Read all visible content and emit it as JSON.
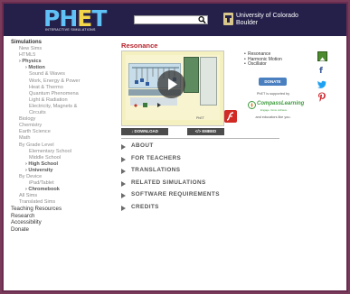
{
  "header": {
    "logo_text_ph": "PH",
    "logo_text_e": "E",
    "logo_text_t": "T",
    "logo_subtitle": "INTERACTIVE SIMULATIONS",
    "search_placeholder": "",
    "cu_line1": "University of Colorado",
    "cu_line2": "Boulder"
  },
  "sidebar": {
    "items": [
      {
        "label": "Simulations"
      },
      {
        "label": "New Sims"
      },
      {
        "label": "HTML5"
      },
      {
        "label": "› Physics"
      },
      {
        "label": "› Motion"
      },
      {
        "label": "Sound & Waves"
      },
      {
        "label": "Work, Energy & Power"
      },
      {
        "label": "Heat & Thermo"
      },
      {
        "label": "Quantum Phenomena"
      },
      {
        "label": "Light & Radiation"
      },
      {
        "label": "Electricity, Magnets &"
      },
      {
        "label": "Circuits"
      },
      {
        "label": "Biology"
      },
      {
        "label": "Chemistry"
      },
      {
        "label": "Earth Science"
      },
      {
        "label": "Math"
      },
      {
        "label": "By Grade Level"
      },
      {
        "label": "Elementary School"
      },
      {
        "label": "Middle School"
      },
      {
        "label": "› High School"
      },
      {
        "label": "› University"
      },
      {
        "label": "By Device"
      },
      {
        "label": "iPad/Tablet"
      },
      {
        "label": "› Chromebook"
      },
      {
        "label": "All Sims"
      },
      {
        "label": "Translated Sims"
      }
    ],
    "sections": [
      {
        "label": "Teaching Resources"
      },
      {
        "label": "Research"
      },
      {
        "label": "Accessibility"
      },
      {
        "label": "Donate"
      }
    ]
  },
  "main": {
    "title": "Resonance",
    "sim_brand": "PhET",
    "download_label": "↓  DOWNLOAD",
    "embed_label": "</>  EMBED",
    "accordions": [
      {
        "label": "ABOUT"
      },
      {
        "label": "FOR TEACHERS"
      },
      {
        "label": "TRANSLATIONS"
      },
      {
        "label": "RELATED SIMULATIONS"
      },
      {
        "label": "SOFTWARE REQUIREMENTS"
      },
      {
        "label": "CREDITS"
      }
    ]
  },
  "right": {
    "topics": [
      "Resonance",
      "Harmonic Motion",
      "Oscillator"
    ],
    "donate_label": "DONATE",
    "supported_by": "PhET is supported by",
    "sponsor_name": "CompassLearning",
    "sponsor_tag": "Engage. Grow. Achieve.",
    "and_educators": "and educators like you."
  },
  "colors": {
    "header_bg": "#25204a",
    "title_red": "#b5232d",
    "page_border": "#7a3b5b",
    "logo_blue": "#5fc1f5",
    "logo_yellow": "#f4d64a",
    "donate_blue": "#4a7fc0"
  },
  "icons": {
    "search": "search-icon",
    "cu": "cu-logo-icon",
    "play": "play-icon",
    "flash": "flash-icon",
    "share": "share-icon",
    "facebook": "facebook-icon",
    "twitter": "twitter-icon",
    "pinterest": "pinterest-icon"
  }
}
